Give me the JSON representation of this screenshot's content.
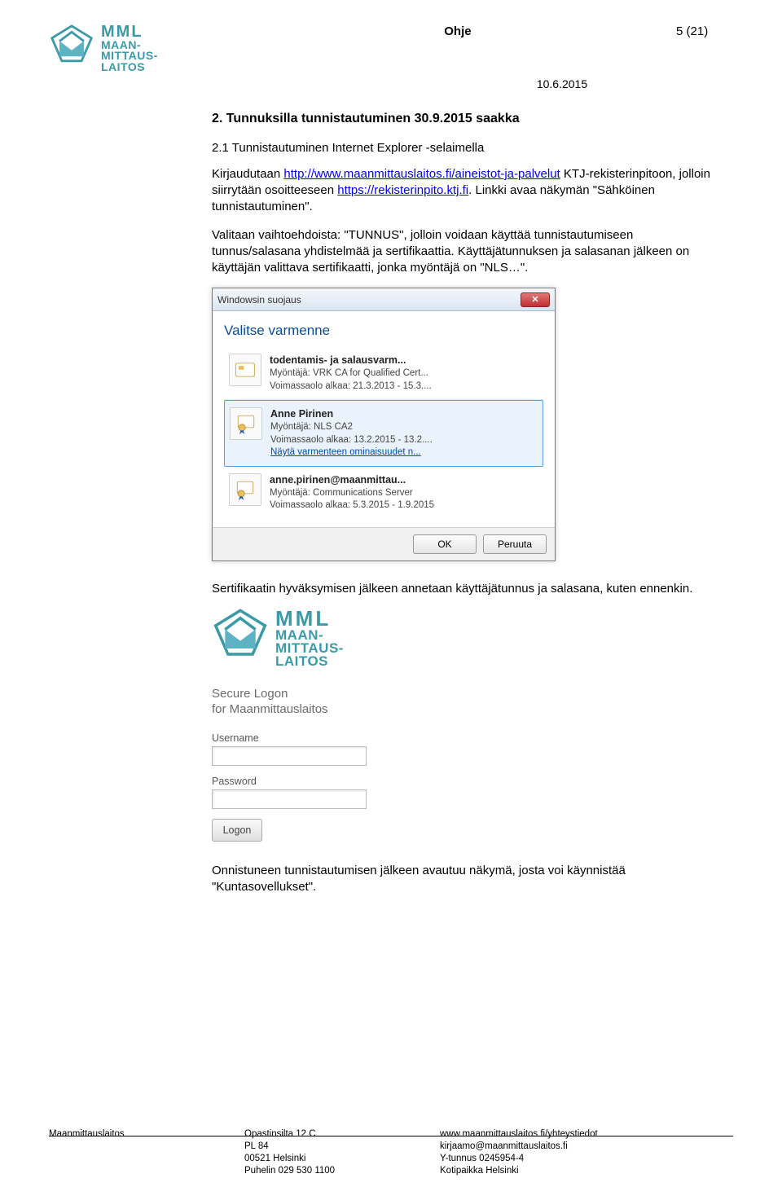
{
  "header": {
    "doc_type": "Ohje",
    "page_info": "5 (21)",
    "date": "10.6.2015"
  },
  "logo": {
    "mml": "MML",
    "l1": "MAAN-",
    "l2": "MITTAUS-",
    "l3": "LAITOS"
  },
  "section": {
    "h1": "2. Tunnuksilla tunnistautuminen 30.9.2015 saakka",
    "h2": "2.1 Tunnistautuminen Internet Explorer -selaimella",
    "p1_a": "Kirjaudutaan ",
    "p1_link": "http://www.maanmittauslaitos.fi/aineistot-ja-palvelut",
    "p1_b": " KTJ-rekisterinpitoon, jolloin siirrytään osoitteeseen ",
    "p1_link2": "https://rekisterinpito.ktj.fi",
    "p1_c": ". Linkki avaa näkymän \"Sähköinen tunnistautuminen\".",
    "p2": "Valitaan vaihtoehdoista: \"TUNNUS\", jolloin voidaan käyttää tunnistautumiseen tunnus/salasana yhdistelmää ja sertifikaattia. Käyttäjätunnuksen ja salasanan jälkeen on käyttäjän valittava sertifikaatti, jonka myöntäjä on \"NLS…\".",
    "p3": "Sertifikaatin hyväksymisen jälkeen annetaan käyttäjätunnus ja salasana, kuten ennenkin.",
    "p4": "Onnistuneen tunnistautumisen jälkeen avautuu näkymä, josta voi käynnistää \"Kuntasovellukset\"."
  },
  "dialog": {
    "titlebar": "Windowsin suojaus",
    "close": "✕",
    "prompt": "Valitse varmenne",
    "certs": [
      {
        "title": "todentamis- ja salausvarm...",
        "issuer": "Myöntäjä: VRK CA for Qualified Cert...",
        "valid": "Voimassaolo alkaa: 21.3.2013 - 15.3...."
      },
      {
        "title": "Anne Pirinen",
        "issuer": "Myöntäjä: NLS CA2",
        "valid": "Voimassaolo alkaa: 13.2.2015 - 13.2....",
        "link": "Näytä varmenteen ominaisuudet n..."
      },
      {
        "title": "anne.pirinen@maanmittau...",
        "issuer": "Myöntäjä: Communications Server",
        "valid": "Voimassaolo alkaa: 5.3.2015 - 1.9.2015"
      }
    ],
    "ok": "OK",
    "cancel": "Peruuta"
  },
  "logon": {
    "title_l1": "Secure Logon",
    "title_l2": "for Maanmittauslaitos",
    "username_label": "Username",
    "password_label": "Password",
    "button": "Logon"
  },
  "footer": {
    "c1": "Maanmittauslaitos",
    "c2_l1": "Opastinsilta 12 C",
    "c2_l2": "PL 84",
    "c2_l3": "00521 Helsinki",
    "c2_l4": "Puhelin 029 530 1100",
    "c3_l1": "www.maanmittauslaitos.fi/yhteystiedot",
    "c3_l2": "kirjaamo@maanmittauslaitos.fi",
    "c3_l3": "Y-tunnus 0245954-4",
    "c3_l4": "Kotipaikka Helsinki"
  }
}
